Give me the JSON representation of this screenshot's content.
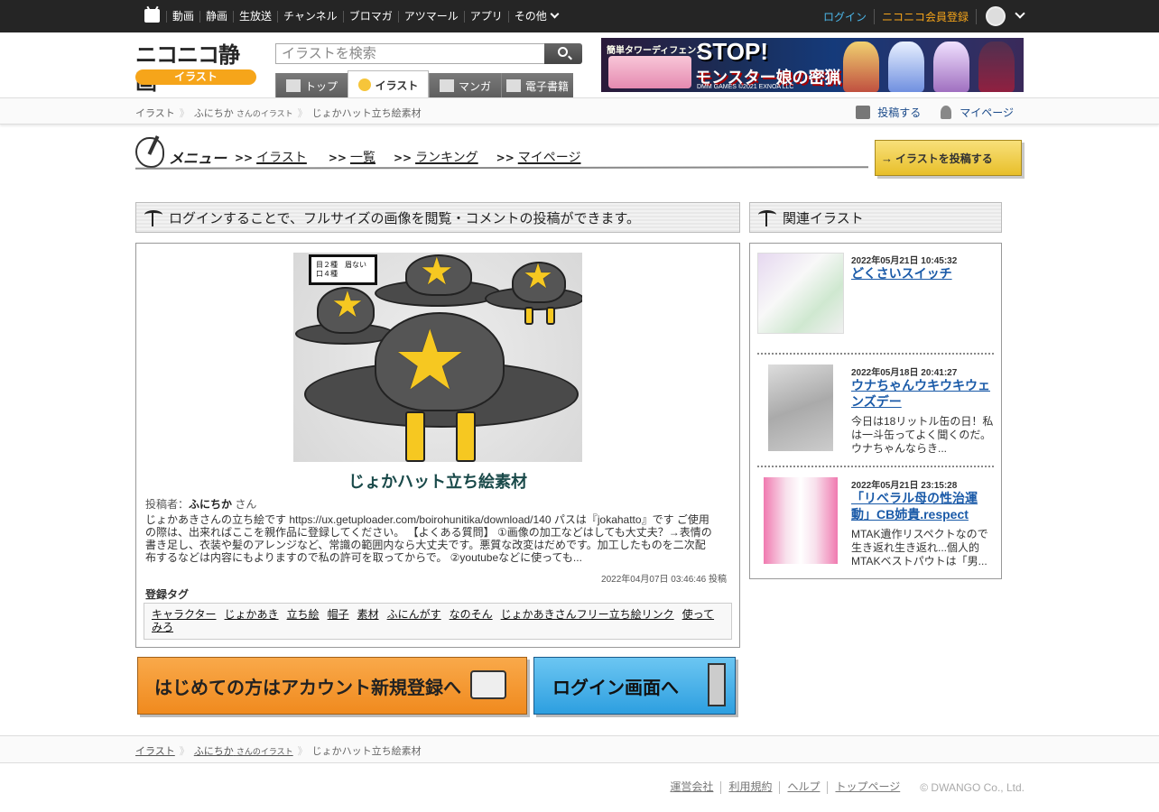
{
  "global_nav": {
    "items": [
      "動画",
      "静画",
      "生放送",
      "チャンネル",
      "ブロマガ",
      "アツマール",
      "アプリ",
      "その他"
    ],
    "login": "ログイン",
    "register": "ニコニコ会員登録"
  },
  "header": {
    "logo_text": "ニコニコ静画",
    "logo_sub": "イラスト",
    "search_placeholder": "イラストを検索",
    "tabs": [
      "トップ",
      "イラスト",
      "マンガ",
      "電子書籍"
    ],
    "active_tab": "イラスト",
    "ad": {
      "line1": "簡単タワーディフェンス",
      "line2": "STOP!",
      "line3": "モンスター娘の密猟",
      "line4": "DMM GAMES  ©2021 EXNOA LLC"
    }
  },
  "breadcrumb": {
    "root": "イラスト",
    "user": "ふにちか",
    "user_suffix": "さんのイラスト",
    "current": "じょかハット立ち絵素材",
    "post_link": "投稿する",
    "mypage_link": "マイページ"
  },
  "menu": {
    "title": "メニュー",
    "links": [
      "イラスト",
      "一覧",
      "ランキング",
      "マイページ"
    ],
    "arrow": ">>",
    "post_button": "イラストを投稿する"
  },
  "notice": "ログインすることで、フルサイズの画像を閲覧・コメントの投稿ができます。",
  "artwork": {
    "label_line1": "目２種　眉ない",
    "label_line2": "口４種",
    "title": "じょかハット立ち絵素材",
    "author_prefix": "投稿者：",
    "author": "ふにちか",
    "author_suffix": "さん",
    "description": "じょかあきさんの立ち絵です https://ux.getuploader.com/boirohunitika/download/140 パスは『jokahatto』です ご使用の際は、出来ればここを親作品に登録してください。 【よくある質問】 ①画像の加工などはしても大丈夫？→表情の書き足し、衣装や髪のアレンジなど、常識の範囲内なら大丈夫です。悪質な改変はだめです。加工したものを二次配布するなどは内容にもよりますので私の許可を取ってからで。 ②youtubeなどに使っても...",
    "posted": "2022年04月07日 03:46:46 投稿",
    "tags_heading": "登録タグ",
    "tags": [
      "キャラクター",
      "じょかあき",
      "立ち絵",
      "帽子",
      "素材",
      "ふにんがす",
      "なのそん",
      "じょかあきさんフリー立ち絵リンク",
      "使ってみろ"
    ]
  },
  "cta": {
    "register": "はじめての方はアカウント新規登録へ",
    "login": "ログイン画面へ"
  },
  "related": {
    "heading": "関連イラスト",
    "items": [
      {
        "date": "2022年05月21日 10:45:32",
        "title": "どくさいスイッチ",
        "snippet": ""
      },
      {
        "date": "2022年05月18日 20:41:27",
        "title": "ウナちゃんウキウキウェンズデー",
        "snippet": "今日は18リットル缶の日！私は一斗缶ってよく聞くのだ。ウナちゃんならき..."
      },
      {
        "date": "2022年05月21日 23:15:28",
        "title": "「リベラル母の性治運動」CB姉貴.respect",
        "snippet": "MTAK遺作リスペクトなので生き返れ生き返れ...個人的MTAKベストパウトは「男..."
      }
    ]
  },
  "footer": {
    "links": [
      "運営会社",
      "利用規約",
      "ヘルプ",
      "トップページ"
    ],
    "copyright": "© DWANGO Co., Ltd."
  }
}
